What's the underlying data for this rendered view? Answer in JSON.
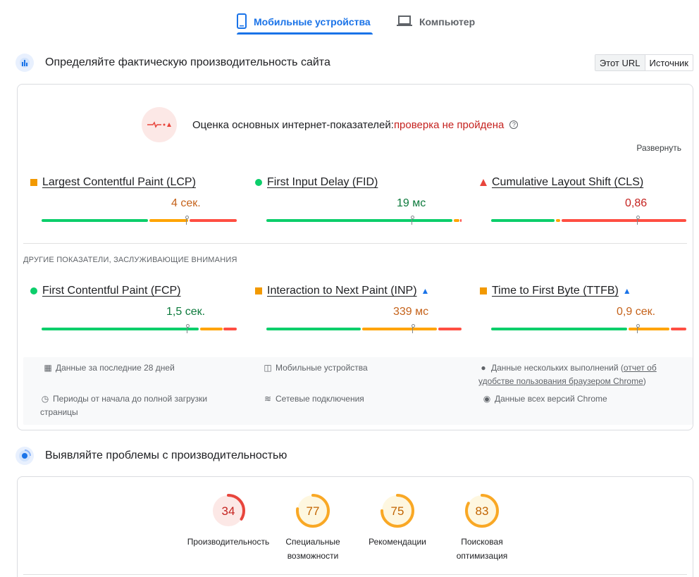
{
  "tabs": [
    {
      "label": "Мобильные устройства",
      "icon": "smartphone-icon",
      "active": true
    },
    {
      "label": "Компьютер",
      "icon": "laptop-icon",
      "active": false
    }
  ],
  "field": {
    "title": "Определяйте фактическую производительность сайта",
    "toggle": [
      "Этот URL",
      "Источник"
    ],
    "assessment_label": "Оценка основных интернет-показателей:",
    "assessment_result": "проверка не пройдена",
    "expand": "Развернуть",
    "core_metrics": [
      {
        "name": "Largest Contentful Paint (LCP)",
        "value": "4 сек.",
        "status": "average",
        "indicator": "orange-square-icon"
      },
      {
        "name": "First Input Delay (FID)",
        "value": "19 мс",
        "status": "good",
        "indicator": "green-circle-icon"
      },
      {
        "name": "Cumulative Layout Shift (CLS)",
        "value": "0,86",
        "status": "poor",
        "indicator": "red-triangle-icon"
      }
    ],
    "other_heading": "ДРУГИЕ ПОКАЗАТЕЛИ, ЗАСЛУЖИВАЮЩИЕ ВНИМАНИЯ",
    "other_metrics": [
      {
        "name": "First Contentful Paint (FCP)",
        "value": "1,5 сек.",
        "status": "good",
        "indicator": "green-circle-icon",
        "experimental": false
      },
      {
        "name": "Interaction to Next Paint (INP)",
        "value": "339 мс",
        "status": "average",
        "indicator": "orange-square-icon",
        "experimental": true
      },
      {
        "name": "Time to First Byte (TTFB)",
        "value": "0,9 сек.",
        "status": "average",
        "indicator": "orange-square-icon",
        "experimental": true
      }
    ],
    "info": {
      "period": "Данные за последние 28 дней",
      "devices": "Мобильные устройства",
      "multi_1": "Данные нескольких выполнений (",
      "multi_link": "отчет об удобстве пользования браузером Chrome",
      "multi_2": ")",
      "duration": "Периоды от начала до полной загрузки страницы",
      "network": "Сетевые подключения",
      "chrome": "Данные всех версий Chrome"
    }
  },
  "lab": {
    "title": "Выявляйте проблемы с производительностью",
    "scores": [
      {
        "value": "34",
        "label": "Производительность",
        "color": "#e8453c",
        "fraction": 0.34
      },
      {
        "value": "77",
        "label": "Специальные возможности",
        "color": "#f9a825",
        "fraction": 0.77
      },
      {
        "value": "75",
        "label": "Рекомендации",
        "color": "#f9a825",
        "fraction": 0.75
      },
      {
        "value": "83",
        "label": "Поисковая оптимизация",
        "color": "#f9a825",
        "fraction": 0.83
      }
    ]
  },
  "colors": {
    "good": "#0cce6b",
    "average": "#ffa400",
    "poor": "#ff4e42",
    "accent": "#1a73e8"
  }
}
